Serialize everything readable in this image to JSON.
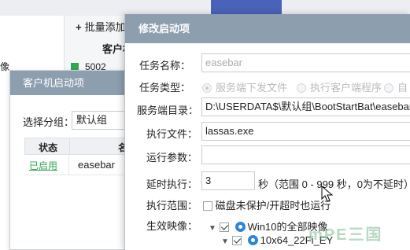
{
  "background": {
    "side_fragment": "像",
    "toolbar": {
      "plus_icon": "+",
      "batch_add_label": "批量添加"
    },
    "table_header": "客户机",
    "row_value": "5002"
  },
  "client_dialog": {
    "title": "客户机启动项",
    "group_label": "选择分组：",
    "group_value": "默认组",
    "columns": {
      "status": "状态",
      "name": "名"
    },
    "rows": [
      {
        "status": "已启用",
        "name": "easebar"
      }
    ]
  },
  "edit_dialog": {
    "title": "修改启动项",
    "task_name_label": "任务名称：",
    "task_name_value": "easebar",
    "task_type_label": "任务类型：",
    "task_type_options": [
      "服务端下发文件",
      "执行客户端程序",
      "自"
    ],
    "server_dir_label": "服务端目录：",
    "server_dir_value": "D:\\USERDATA$\\默认组\\BootStartBat\\easebar\\",
    "exec_file_label": "执行文件：",
    "exec_file_value": "lassas.exe",
    "params_label": "运行参数：",
    "params_value": "",
    "delay_label": "延时执行：",
    "delay_value": "3",
    "delay_hint": "秒（范围 0 - 999 秒，0为不延时）",
    "scope_label": "执行范围：",
    "scope_checkbox_label": "磁盘未保护/开超时也运行",
    "images_label": "生效映像：",
    "tree": [
      {
        "label": "Win10的全部映像",
        "checked": true
      },
      {
        "label": "10x64_22Fi_EY",
        "checked": true
      }
    ]
  },
  "watermark": "mPE三国",
  "colors": {
    "titlebar": "#8d9eaf",
    "accent": "#4a63b8",
    "enabled": "#2fa84f",
    "disk": "#2d87d6"
  }
}
